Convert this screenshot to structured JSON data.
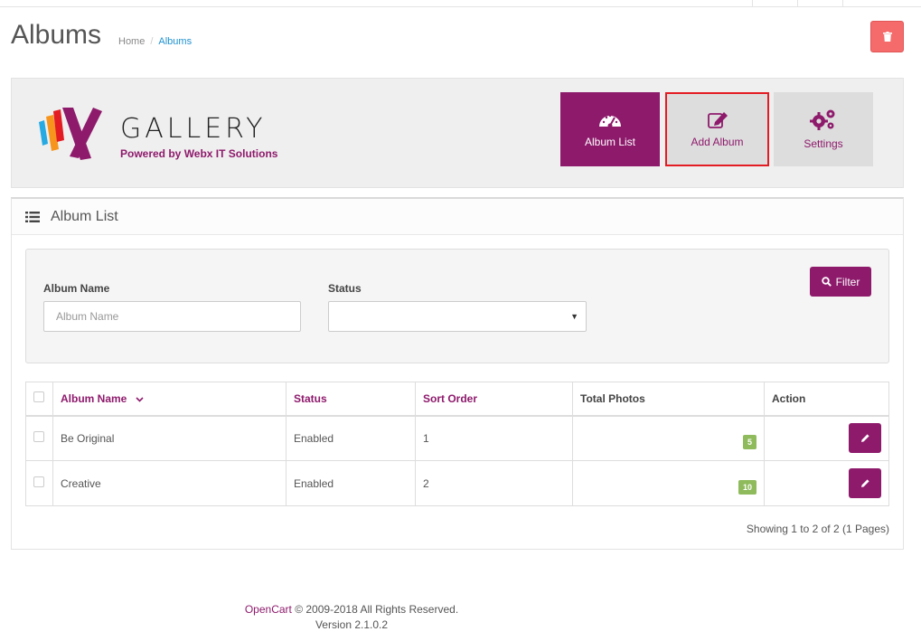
{
  "header": {
    "title": "Albums",
    "breadcrumb": [
      {
        "label": "Home"
      },
      {
        "label": "Albums"
      }
    ]
  },
  "brand": {
    "logo_text": "GALLERY",
    "logo_tagline": "Powered by Webx IT Solutions"
  },
  "nav": {
    "album_list": "Album List",
    "add_album": "Add Album",
    "settings": "Settings"
  },
  "panel": {
    "heading": "Album List"
  },
  "filter": {
    "album_name_label": "Album Name",
    "album_name_placeholder": "Album Name",
    "status_label": "Status",
    "status_value": "",
    "button": "Filter"
  },
  "table": {
    "columns": [
      "Album Name",
      "Status",
      "Sort Order",
      "Total Photos",
      "Action"
    ],
    "rows": [
      {
        "name": "Be Original",
        "status": "Enabled",
        "sort_order": "1",
        "total_photos": "5"
      },
      {
        "name": "Creative",
        "status": "Enabled",
        "sort_order": "2",
        "total_photos": "10"
      }
    ]
  },
  "pagination": {
    "text": "Showing 1 to 2 of 2 (1 Pages)"
  },
  "footer": {
    "brand": "OpenCart",
    "copyright": " © 2009-2018 All Rights Reserved.",
    "version": "Version 2.1.0.2"
  },
  "colors": {
    "accent": "#8e1a6c",
    "danger": "#f56b6b",
    "badge": "#8fbb5c",
    "highlight": "#e31b23"
  }
}
